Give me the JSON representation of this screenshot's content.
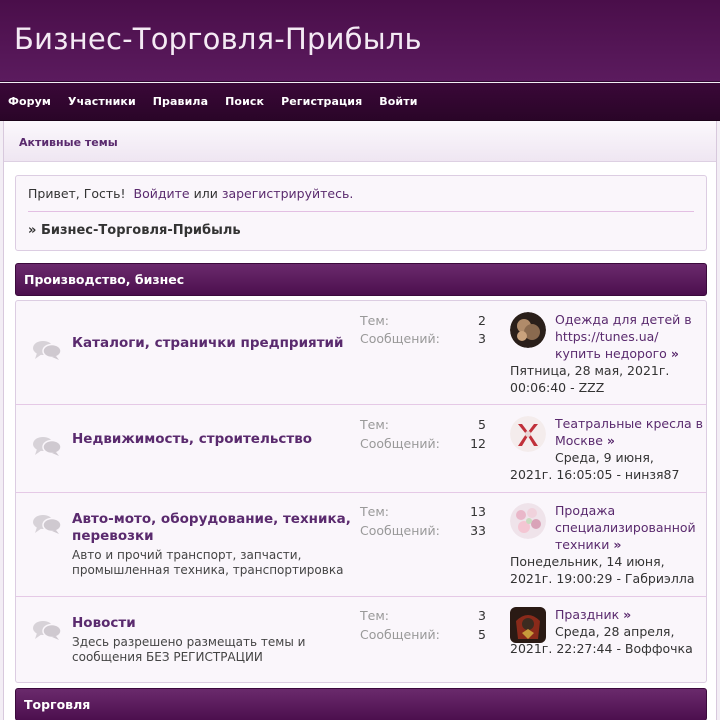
{
  "header": {
    "title": "Бизнес-Торговля-Прибыль"
  },
  "nav": {
    "forum": "Форум",
    "members": "Участники",
    "rules": "Правила",
    "search": "Поиск",
    "register": "Регистрация",
    "login": "Войти"
  },
  "active_topics": "Активные темы",
  "greeting": {
    "hello": "Привет, Гость!",
    "login_link": "Войдите",
    "or": "или",
    "register_link": "зарегистрируйтесь."
  },
  "breadcrumb": {
    "prefix": "»",
    "label": "Бизнес-Торговля-Прибыль"
  },
  "stats_labels": {
    "topics": "Тем:",
    "posts": "Сообщений:"
  },
  "categories": [
    {
      "name": "Производство, бизнес",
      "boards": [
        {
          "title": "Каталоги, странички предприятий",
          "desc": "",
          "topics": "2",
          "posts": "3",
          "last_topic": "Одежда для детей в https://tunes.ua/ купить недорого",
          "last_meta": "Пятница, 28 мая, 2021г. 00:06:40 - ZZZ"
        },
        {
          "title": "Недвижимость, строительство",
          "desc": "",
          "topics": "5",
          "posts": "12",
          "last_topic": "Театральные кресла в Москве",
          "last_meta": "Среда, 9 июня, 2021г. 16:05:05 - нинзя87"
        },
        {
          "title": "Авто-мото, оборудование, техника, перевозки",
          "desc": "Авто и прочий транспорт, запчасти, промышленная техника, транспортировка",
          "topics": "13",
          "posts": "33",
          "last_topic": "Продажа специализированной техники",
          "last_meta": "Понедельник, 14 июня, 2021г. 19:00:29 - Габриэлла"
        },
        {
          "title": "Новости",
          "desc": "Здесь разрешено размещать темы и сообщения БЕЗ РЕГИСТРАЦИИ",
          "topics": "3",
          "posts": "5",
          "last_topic": "Праздник",
          "last_meta": "Среда, 28 апреля, 2021г. 22:27:44 - Воффочка"
        }
      ]
    },
    {
      "name": "Торговля"
    }
  ],
  "icons": {
    "board": "speech-bubbles-icon",
    "arrow": "»"
  },
  "colors": {
    "header": "#4a0e4a",
    "nav": "#2a0528",
    "link": "#5a2a6e",
    "category_bar": "#5b1b5e"
  }
}
